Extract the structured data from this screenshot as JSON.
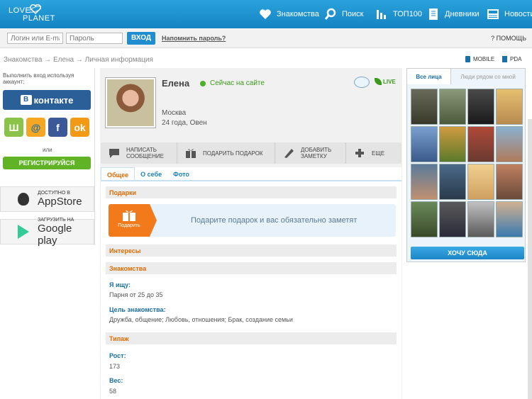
{
  "header": {
    "logo_top": "LOVE",
    "logo_bottom": "PLANET",
    "nav": [
      {
        "label": "Знакомства",
        "icon": "heart-icon"
      },
      {
        "label": "Поиск",
        "icon": "search-icon"
      },
      {
        "label": "ТОП100",
        "icon": "bar-chart-icon"
      },
      {
        "label": "Дневники",
        "icon": "diary-icon"
      },
      {
        "label": "Новости",
        "icon": "news-icon"
      }
    ]
  },
  "login": {
    "login_placeholder": "Логин или E-mail",
    "password_placeholder": "Пароль",
    "submit": "ВХОД",
    "remind": "Напомнить пароль?",
    "help": "? ПОМОЩЬ"
  },
  "breadcrumbs": "Знакомства → Елена → Личная информация",
  "versions": {
    "mobile": "MOBILE",
    "pda": "PDA"
  },
  "left": {
    "login_with": "Выполнить вход используя аккаунт:",
    "vk": "контакте",
    "or": "или",
    "register": "РЕГИСТРИРУЙСЯ",
    "appstore_top": "ДОСТУПНО В",
    "appstore_name": "AppStore",
    "gplay_top": "ЗАГРУЗИТЬ НА",
    "gplay_name": "Google play"
  },
  "profile": {
    "name": "Елена",
    "status": "Сейчас на сайте",
    "live": "LIVE",
    "city": "Москва",
    "age": "24 года, Овен"
  },
  "actions": [
    {
      "label": "НАПИСАТЬ СООБЩЕНИЕ",
      "icon": "message-icon"
    },
    {
      "label": "ПОДАРИТЬ ПОДАРОК",
      "icon": "gift-icon"
    },
    {
      "label": "ДОБАВИТЬ ЗАМЕТКУ",
      "icon": "note-icon"
    },
    {
      "label": "ЕЩЕ",
      "icon": "plus-icon"
    }
  ],
  "tabs": [
    "Общее",
    "О себе",
    "Фото"
  ],
  "sections": {
    "gifts": "Подарки",
    "gift_button": "Подарить",
    "gift_text": "Подарите подарок и вас обязательно заметят",
    "interests": "Интересы",
    "dating": "Знакомства",
    "looking_label": "Я ищу:",
    "looking_value": "Парня от 25 до 35",
    "goal_label": "Цель знакомства:",
    "goal_value": "Дружба, общение; Любовь, отношения; Брак, создание семьи",
    "type": "Типаж",
    "height_label": "Рост:",
    "height_value": "173",
    "weight_label": "Вес:",
    "weight_value": "58"
  },
  "right": {
    "tab_all": "Все лица",
    "tab_near": "Люди рядом со мной",
    "want": "ХОЧУ СЮДА"
  },
  "colors": {
    "brand": "#1a8fd0",
    "accent": "#e06a00",
    "vk": "#2a5f97",
    "register": "#5fb325"
  }
}
